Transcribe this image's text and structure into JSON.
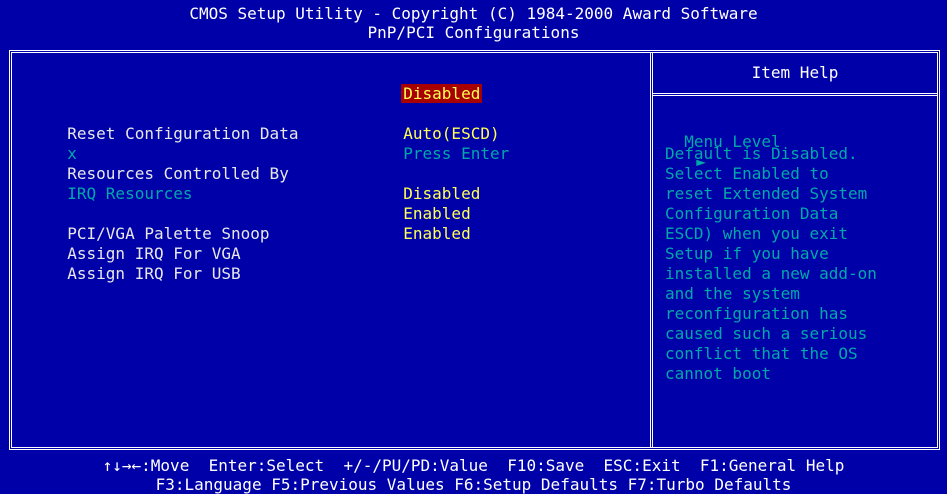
{
  "header": {
    "line1": "CMOS Setup Utility - Copyright (C) 1984-2000 Award Software",
    "line2": "PnP/PCI Configurations"
  },
  "settings": [
    {
      "prefix": " ",
      "label": "Reset Configuration Data",
      "value": "Disabled",
      "selected": true,
      "disabled": false
    },
    {
      "prefix": " ",
      "label": "Resources Controlled By",
      "value": "Auto(ESCD)",
      "selected": false,
      "disabled": false
    },
    {
      "prefix": "x",
      "label": "IRQ Resources",
      "value": "Press Enter",
      "selected": false,
      "disabled": true
    },
    {
      "prefix": " ",
      "label": "PCI/VGA Palette Snoop",
      "value": "Disabled",
      "selected": false,
      "disabled": false
    },
    {
      "prefix": " ",
      "label": "Assign IRQ For VGA",
      "value": "Enabled",
      "selected": false,
      "disabled": false
    },
    {
      "prefix": " ",
      "label": "Assign IRQ For USB",
      "value": "Enabled",
      "selected": false,
      "disabled": false
    }
  ],
  "help_panel": {
    "title": "Item Help",
    "menu_level_label": "Menu Level",
    "menu_level_icon": "right-triangle-icon",
    "text_lines": [
      "Default is Disabled.",
      "Select Enabled to",
      "reset Extended System",
      "Configuration Data",
      "ESCD) when you exit",
      "Setup if you have",
      "installed a new add-on",
      "and the system",
      "reconfiguration has",
      "caused such a serious",
      "conflict that the OS",
      "cannot boot"
    ]
  },
  "footer": {
    "line1": "↑↓→←:Move  Enter:Select  +/-/PU/PD:Value  F10:Save  ESC:Exit  F1:General Help",
    "line2": "F3:Language F5:Previous Values F6:Setup Defaults F7:Turbo Defaults"
  },
  "colors": {
    "background": "#0000a8",
    "value": "#ffff55",
    "help_text": "#00a8a8",
    "selection": "#a80000"
  }
}
